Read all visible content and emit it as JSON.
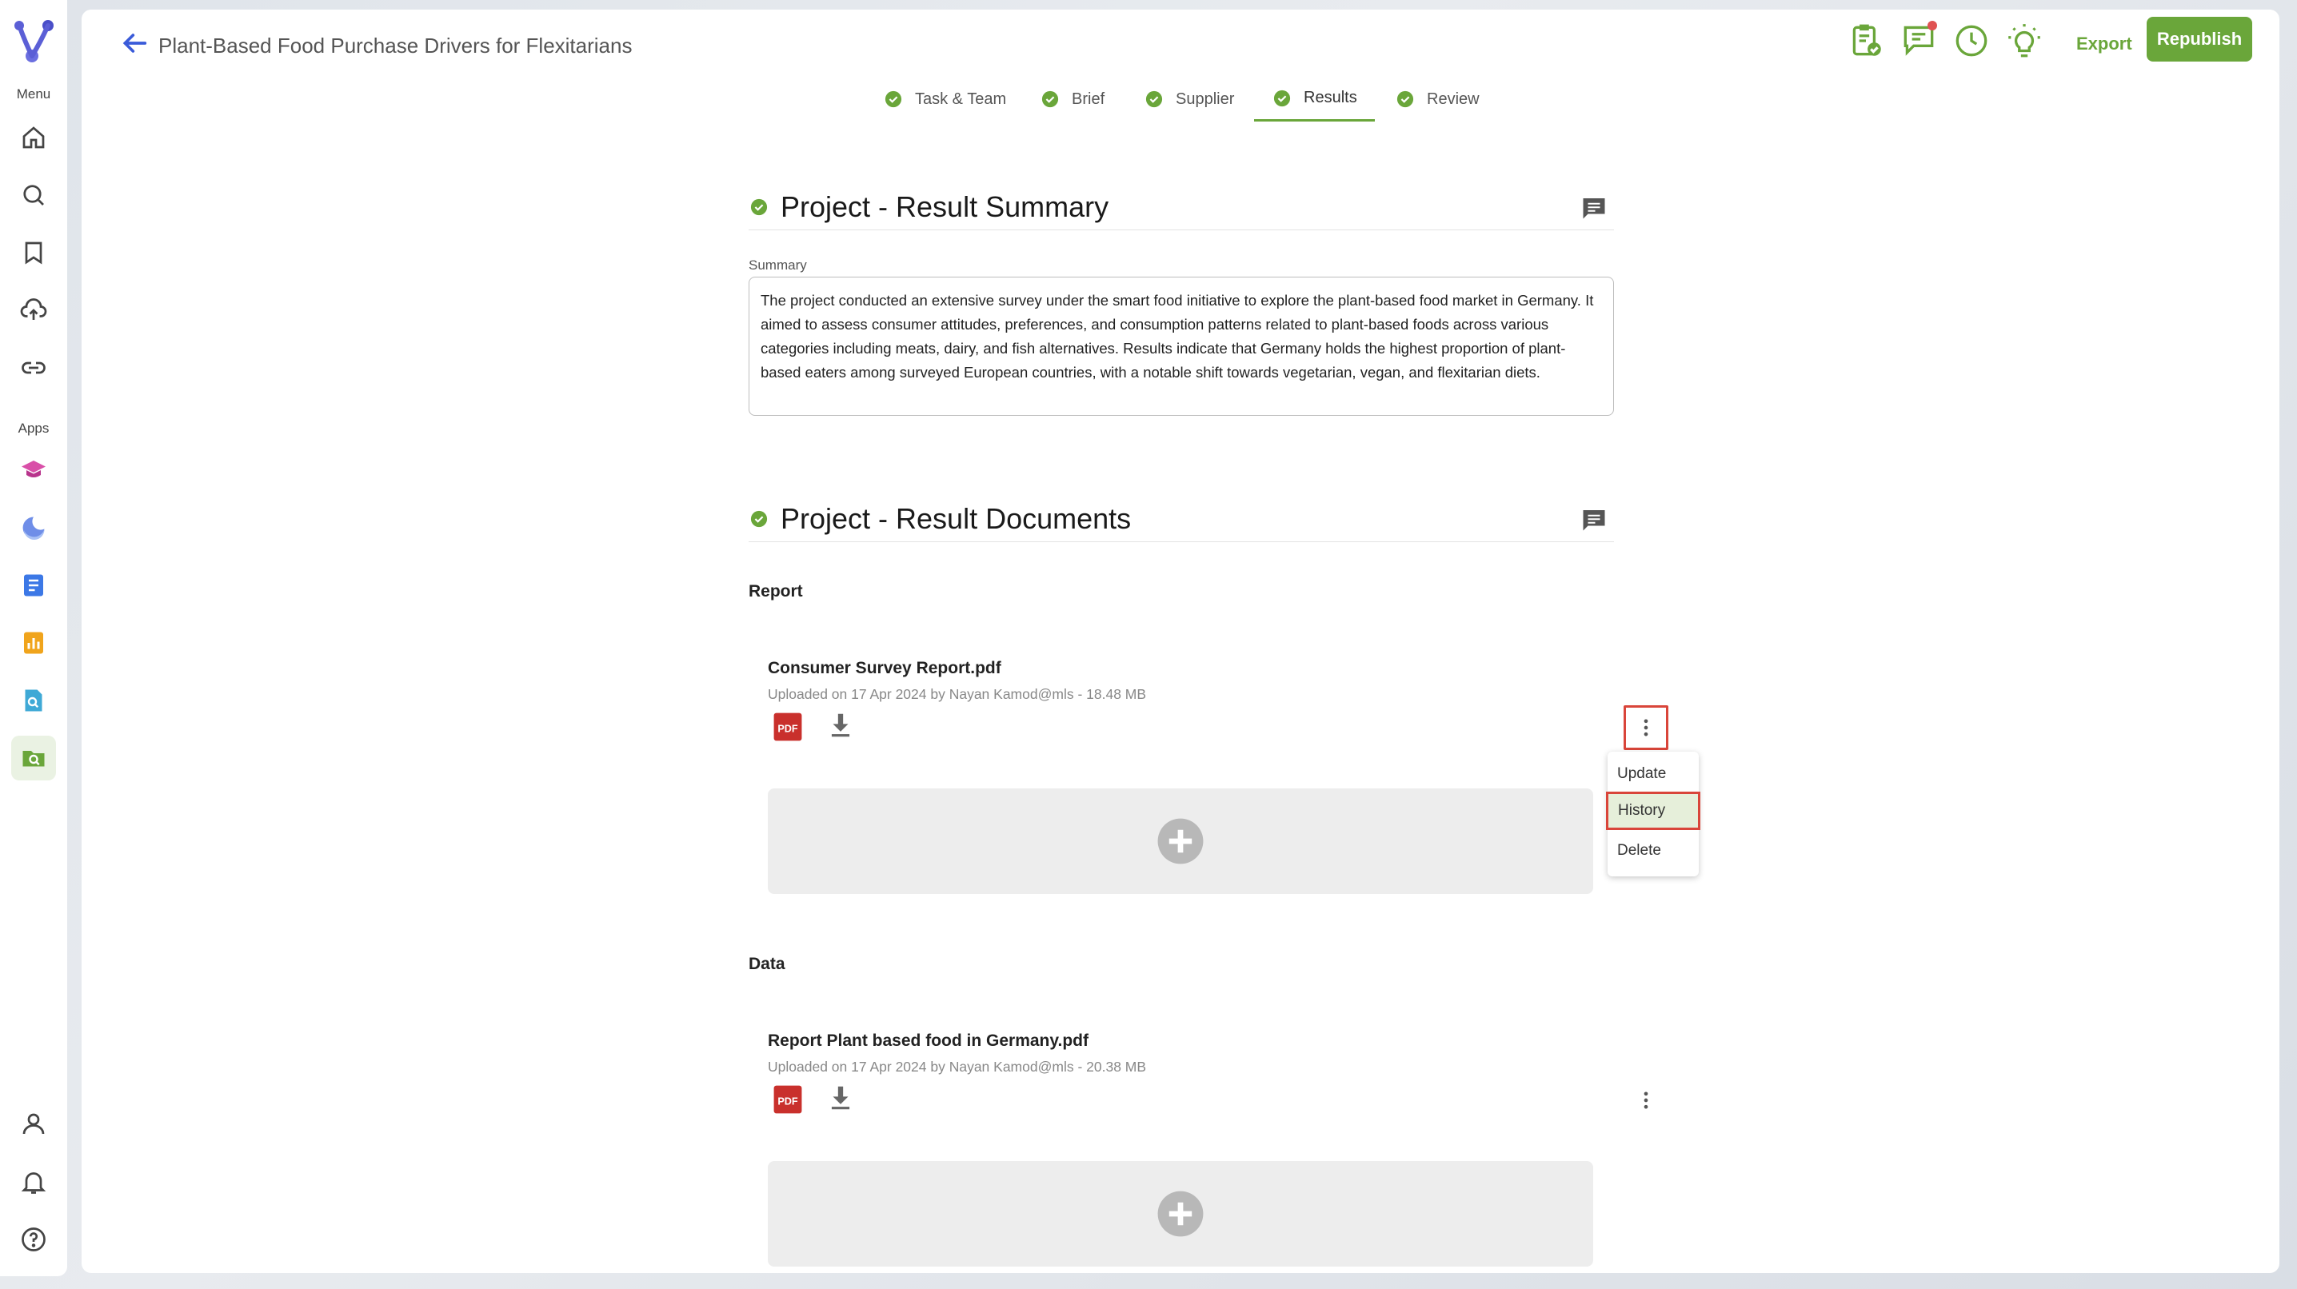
{
  "sidebar": {
    "menu_label": "Menu",
    "apps_label": "Apps",
    "nav_icons": [
      "home-icon",
      "search-icon",
      "bookmark-icon",
      "upload-cloud-icon",
      "link-icon"
    ],
    "app_icons": [
      "app-graduation-icon",
      "app-moon-icon",
      "app-document-icon",
      "app-chart-icon",
      "app-search-doc-icon",
      "app-folder-search-icon"
    ],
    "bottom_icons": [
      "user-icon",
      "bell-icon",
      "help-icon"
    ]
  },
  "header": {
    "title": "Plant-Based Food Purchase Drivers for Flexitarians",
    "export_label": "Export",
    "republish_label": "Republish",
    "accent_color": "#6aa63a"
  },
  "tabs": [
    {
      "label": "Task & Team"
    },
    {
      "label": "Brief"
    },
    {
      "label": "Supplier"
    },
    {
      "label": "Results"
    },
    {
      "label": "Review"
    }
  ],
  "summary_section": {
    "title": "Project - Result Summary",
    "field_label": "Summary",
    "text": "The project conducted an extensive survey under the smart food initiative to explore the plant-based food market in Germany. It aimed to assess consumer attitudes, preferences, and consumption patterns related to plant-based foods across various categories including meats, dairy, and fish alternatives. Results indicate that Germany holds the highest proportion of plant-based eaters among surveyed European countries, with a notable shift towards vegetarian, vegan, and flexitarian diets."
  },
  "documents_section": {
    "title": "Project - Result Documents",
    "groups": [
      {
        "label": "Report",
        "doc_name": "Consumer Survey Report.pdf",
        "doc_meta": "Uploaded on 17 Apr 2024 by Nayan Kamod@mls - 18.48 MB"
      },
      {
        "label": "Data",
        "doc_name": "Report Plant based food in Germany.pdf",
        "doc_meta": "Uploaded on 17 Apr 2024 by Nayan Kamod@mls - 20.38 MB"
      }
    ]
  },
  "context_menu": {
    "items": [
      {
        "label": "Update"
      },
      {
        "label": "History"
      },
      {
        "label": "Delete"
      }
    ]
  }
}
